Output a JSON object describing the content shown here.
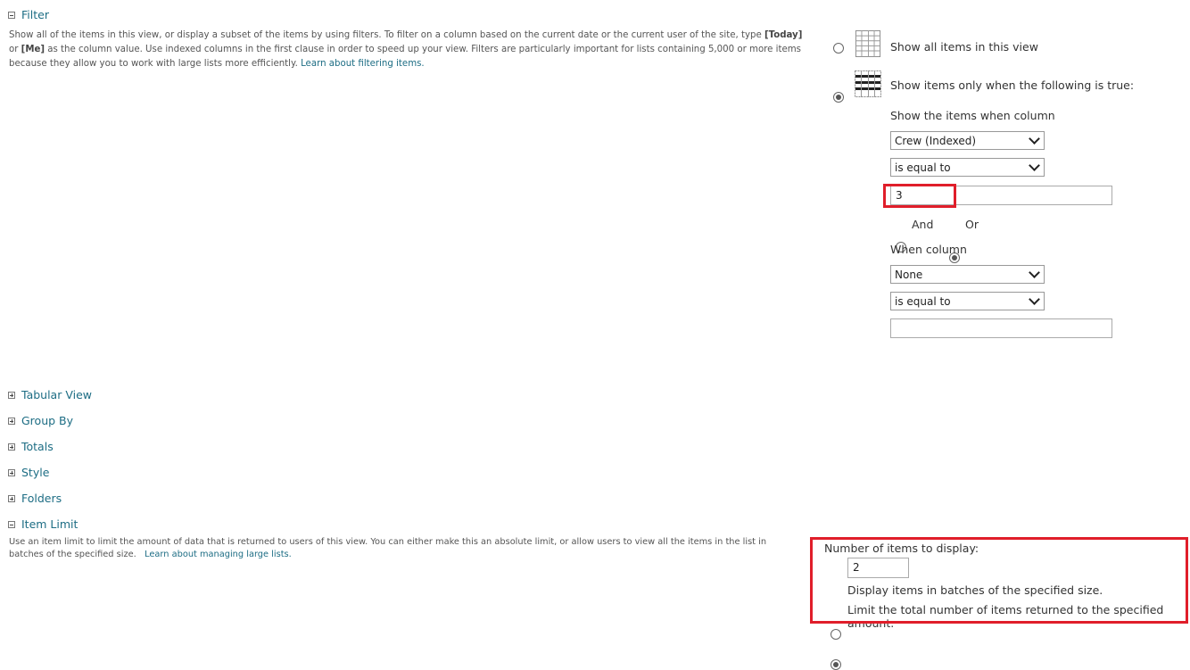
{
  "filter": {
    "title": "Filter",
    "description_part1": "Show all of the items in this view, or display a subset of the items by using filters. To filter on a column based on the current date or the current user of the site, type ",
    "today_token": "[Today]",
    "description_part2": " or ",
    "me_token": "[Me]",
    "description_part3": " as the column value. Use indexed columns in the first clause in order to speed up your view. Filters are particularly important for lists containing 5,000 or more items because they allow you to work with large lists more efficiently. ",
    "learn_link": "Learn about filtering items.",
    "show_all_label": "Show all items in this view",
    "show_only_label": "Show items only when the following is true:",
    "show_only_selected": true,
    "column_label": "Show the items when column",
    "column1_value": "Crew (Indexed)",
    "operator1_value": "is equal to",
    "value1": "3",
    "and_label": "And",
    "or_label": "Or",
    "logic_selected": "Or",
    "when_column_label": "When column",
    "column2_value": "None",
    "operator2_value": "is equal to",
    "value2": ""
  },
  "sections": [
    {
      "title": "Tabular View"
    },
    {
      "title": "Group By"
    },
    {
      "title": "Totals"
    },
    {
      "title": "Style"
    },
    {
      "title": "Folders"
    }
  ],
  "item_limit": {
    "title": "Item Limit",
    "description": "Use an item limit to limit the amount of data that is returned to users of this view. You can either make this an absolute limit, or allow users to view all the items in the list in batches of the specified size.",
    "learn_link": "Learn about managing large lists.",
    "number_label": "Number of items to display:",
    "number_value": "2",
    "batches_label": "Display items in batches of the specified size.",
    "limit_label": "Limit the total number of items returned to the specified amount.",
    "selected": "limit"
  },
  "colors": {
    "link": "#1d6d84",
    "highlight": "#e01e2a"
  },
  "icons": {
    "show_all": "table-grid-icon",
    "show_filtered": "filtered-table-icon"
  }
}
